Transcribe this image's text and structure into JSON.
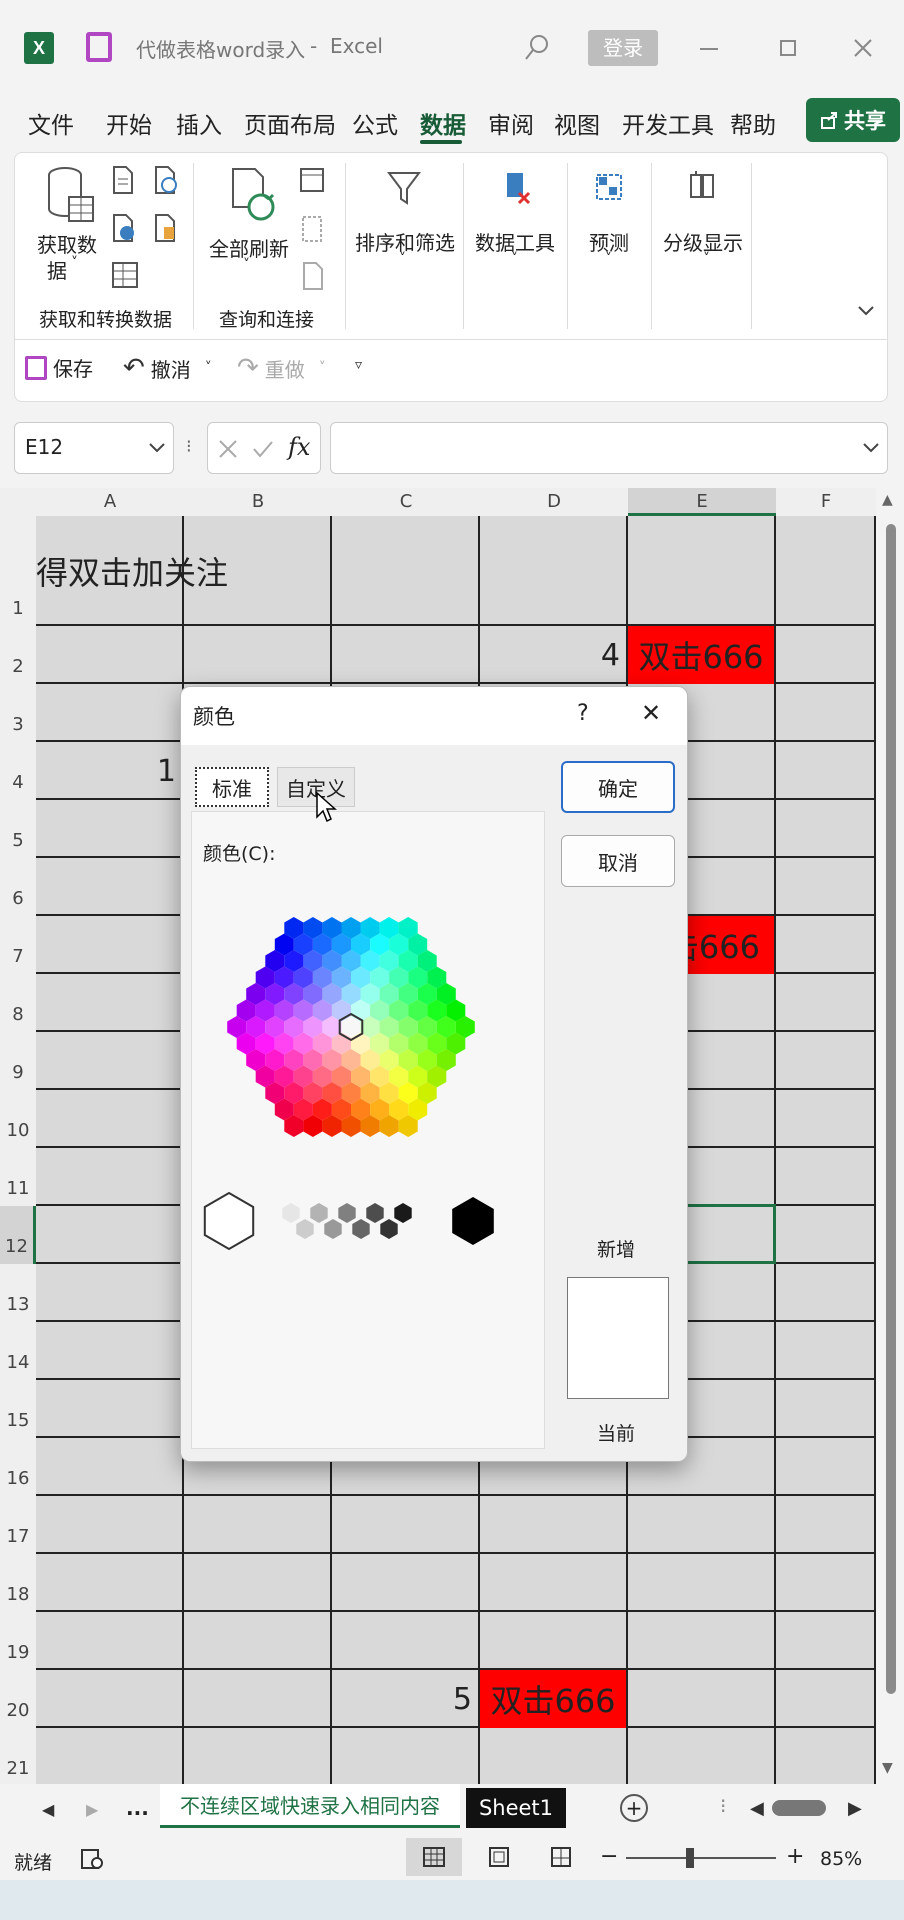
{
  "titlebar": {
    "doc_title": "代做表格word录入",
    "separator": "-",
    "app_name": "Excel",
    "login_label": "登录",
    "colors": {
      "excel_green": "#1f7244",
      "save_purple": "#b146c2"
    }
  },
  "menu": {
    "items": [
      "文件",
      "开始",
      "插入",
      "页面布局",
      "公式",
      "数据",
      "审阅",
      "视图",
      "开发工具",
      "帮助"
    ],
    "active": "数据",
    "share_label": "共享"
  },
  "ribbon": {
    "get_data_label_line1": "获取数",
    "get_data_label_line2": "据",
    "refresh_all_label": "全部刷新",
    "sort_filter_label": "排序和筛选",
    "data_tools_label": "数据工具",
    "forecast_label": "预测",
    "outline_label": "分级显示",
    "group_get_transform": "获取和转换数据",
    "group_queries": "查询和连接"
  },
  "quick_access": {
    "save_label": "保存",
    "undo_label": "撤消",
    "redo_label": "重做"
  },
  "formula_bar": {
    "name_box": "E12",
    "fx_label": "fx",
    "value": ""
  },
  "sheet": {
    "columns": [
      "A",
      "B",
      "C",
      "D",
      "E",
      "F"
    ],
    "rows": [
      "1",
      "2",
      "3",
      "4",
      "5",
      "6",
      "7",
      "8",
      "9",
      "10",
      "11",
      "12",
      "13",
      "14",
      "15",
      "16",
      "17",
      "18",
      "19",
      "20",
      "21"
    ],
    "a1_text": "得双击加关注",
    "d2_value": "4",
    "e2_text": "双击666",
    "a4_value": "1",
    "e7_text": "击666",
    "d20_value": "5",
    "e20_text": "双击666",
    "red": "#ff0000"
  },
  "dialog": {
    "title": "颜色",
    "help": "?",
    "close": "✕",
    "tab_standard": "标准",
    "tab_custom": "自定义",
    "colors_label": "颜色(C):",
    "ok_label": "确定",
    "cancel_label": "取消",
    "new_label": "新增",
    "current_label": "当前"
  },
  "tabs": {
    "ellipsis": "...",
    "tab1": "不连续区域快速录入相同内容",
    "tab2": "Sheet1",
    "add": "+"
  },
  "status": {
    "ready": "就绪",
    "zoom": "85%",
    "minus": "−",
    "plus": "+"
  }
}
